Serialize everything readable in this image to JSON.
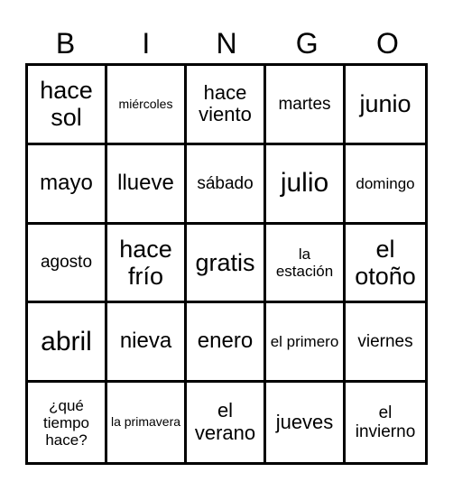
{
  "header": [
    "B",
    "I",
    "N",
    "G",
    "O"
  ],
  "cells": [
    [
      "hace sol",
      "miércoles",
      "hace viento",
      "martes",
      "junio"
    ],
    [
      "mayo",
      "llueve",
      "sábado",
      "julio",
      "domingo"
    ],
    [
      "agosto",
      "hace frío",
      "gratis",
      "la estación",
      "el otoño"
    ],
    [
      "abril",
      "nieva",
      "enero",
      "el primero",
      "viernes"
    ],
    [
      "¿qué tiempo hace?",
      "la primavera",
      "el verano",
      "jueves",
      "el invierno"
    ]
  ]
}
